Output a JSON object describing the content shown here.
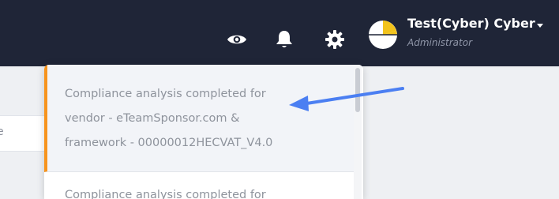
{
  "header": {
    "icons": [
      "eye-icon",
      "bell-icon",
      "gear-icon"
    ],
    "user": {
      "name": "Test(Cyber) Cyber",
      "role": "Administrator"
    }
  },
  "page": {
    "partial_input_text": "e"
  },
  "notifications": [
    {
      "lines": [
        "Compliance analysis completed for",
        "vendor - eTeamSponsor.com &",
        "framework - 00000012HECVAT_V4.0"
      ]
    },
    {
      "partial_text": "Compliance analysis completed for"
    }
  ],
  "colors": {
    "navbar": "#1f2537",
    "accent": "#f7941d",
    "arrow": "#4b7ff2"
  }
}
